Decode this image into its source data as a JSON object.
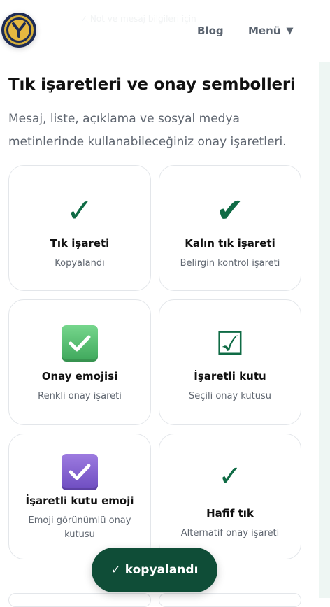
{
  "header": {
    "ghost_text": "✓ Not ve mesaj bilgileri için",
    "nav": {
      "blog": "Blog",
      "menu": "Menü"
    }
  },
  "page": {
    "title": "Tık işaretleri ve onay sembolleri",
    "intro": "Mesaj, liste, açıklama ve sosyal medya metinlerinde kullanabileceğiniz onay işaretleri."
  },
  "cards": [
    {
      "symbol": "✓",
      "icon": "check-mark-icon",
      "title": "Tık işareti",
      "subtitle": "Kopyalandı"
    },
    {
      "symbol": "✔",
      "icon": "heavy-check-mark-icon",
      "title": "Kalın tık işareti",
      "subtitle": "Belirgin kontrol işareti"
    },
    {
      "symbol": "✅",
      "icon": "check-mark-button-emoji-icon",
      "title": "Onay emojisi",
      "subtitle": "Renkli onay işareti"
    },
    {
      "symbol": "☑",
      "icon": "ballot-box-with-check-icon",
      "title": "İşaretli kutu",
      "subtitle": "Seçili onay kutusu"
    },
    {
      "symbol": "☑️",
      "icon": "ballot-box-with-check-emoji-icon",
      "title": "İşaretli kutu emoji",
      "subtitle": "Emoji görünümlü onay kutusu"
    },
    {
      "symbol": "✓",
      "icon": "light-check-mark-icon",
      "title": "Hafif tık",
      "subtitle": "Alternatif onay işareti"
    }
  ],
  "toast": {
    "text": "✓ kopyalandı"
  },
  "colors": {
    "brand_green": "#0f6b45",
    "toast_bg": "#0f4d37",
    "emoji_green": "#4cb868",
    "emoji_purple": "#7c5cd0",
    "logo_navy": "#1e2c55",
    "logo_gold": "#e6b840"
  }
}
